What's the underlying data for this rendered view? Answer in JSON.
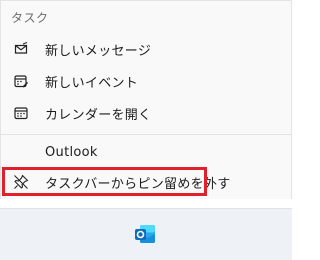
{
  "menu": {
    "section_header": "タスク",
    "tasks": {
      "new_message": {
        "label": "新しいメッセージ",
        "icon": "envelope-icon"
      },
      "new_event": {
        "label": "新しいイベント",
        "icon": "calendar-add-icon"
      },
      "open_calendar": {
        "label": "カレンダーを開く",
        "icon": "calendar-icon"
      }
    },
    "app_name": "Outlook",
    "unpin": {
      "label": "タスクバーからピン留めを外す",
      "icon": "unpin-icon"
    }
  },
  "taskbar": {
    "app_icon": "outlook-icon"
  },
  "colors": {
    "highlight": "#e0202b",
    "outlook_blue": "#0f6cbd"
  }
}
